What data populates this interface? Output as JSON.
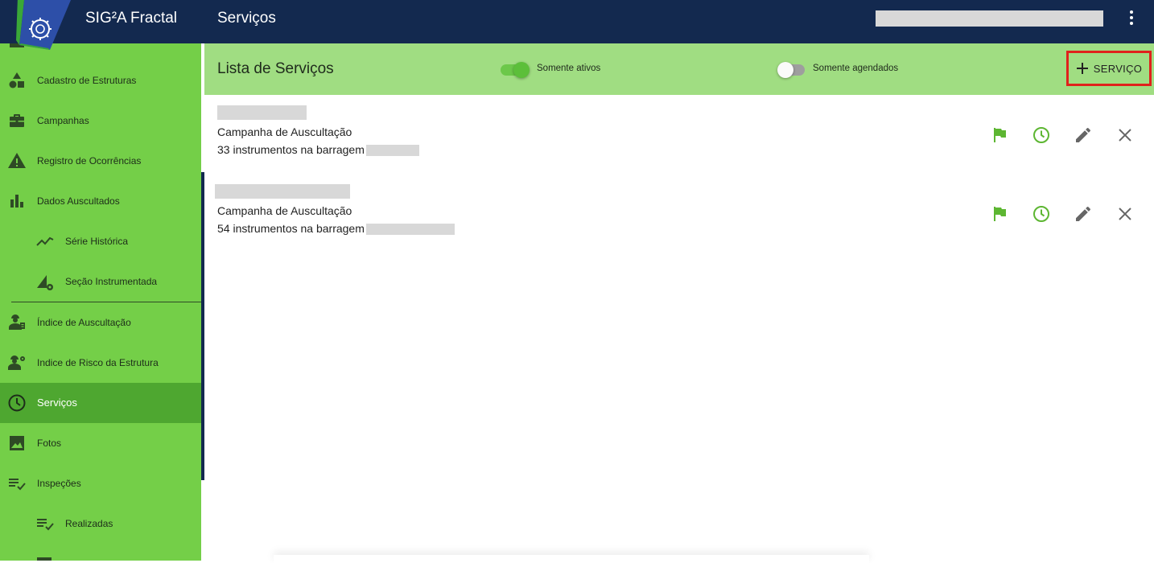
{
  "header": {
    "app_title": "SIG²A Fractal",
    "page_title": "Serviços",
    "colors": {
      "topbar": "#13294f",
      "accent": "#74cf48"
    }
  },
  "sidebar": {
    "items": [
      {
        "label": "Cadastro de Estruturas",
        "icon": "shapes-icon"
      },
      {
        "label": "Campanhas",
        "icon": "briefcase-icon"
      },
      {
        "label": "Registro de Ocorrências",
        "icon": "warning-icon"
      },
      {
        "label": "Dados Auscultados",
        "icon": "bar-chart-icon"
      },
      {
        "label": "Série Histórica",
        "icon": "trend-line-icon"
      },
      {
        "label": "Seção Instrumentada",
        "icon": "section-gear-icon"
      },
      {
        "label": "Índice de Auscultação",
        "icon": "engineer-icon"
      },
      {
        "label": "Indice de Risco da Estrutura",
        "icon": "engineer-gear-icon"
      },
      {
        "label": "Serviços",
        "icon": "clock-icon"
      },
      {
        "label": "Fotos",
        "icon": "image-icon"
      },
      {
        "label": "Inspeções",
        "icon": "checklist-icon"
      },
      {
        "label": "Realizadas",
        "icon": "checklist-icon"
      }
    ],
    "active_item": "Serviços"
  },
  "content": {
    "list_title": "Lista de Serviços",
    "toggle_active_label": "Somente ativos",
    "toggle_scheduled_label": "Somente agendados",
    "add_button_label": "SERVIÇO",
    "services": [
      {
        "type": "Campanha de Auscultação",
        "count": "33 instrumentos na barragem"
      },
      {
        "type": "Campanha de Auscultação",
        "count": "54 instrumentos na barragem"
      }
    ]
  }
}
